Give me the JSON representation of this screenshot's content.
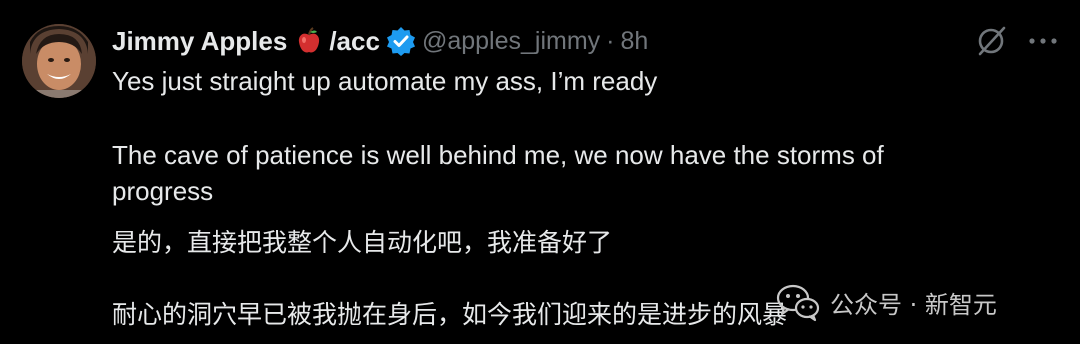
{
  "tweet": {
    "author_name": "Jimmy Apples",
    "author_suffix": "/acc",
    "handle": "@apples_jimmy",
    "separator": "·",
    "time": "8h",
    "avatar_icon": "avatar",
    "badge_icon": "verified-badge-icon",
    "apple_emoji_icon": "apple-emoji-icon",
    "action_icons": [
      "grok-icon",
      "more-icon"
    ],
    "text_line1": "Yes just straight up automate my ass, I’m ready",
    "text_line2": "The cave of patience is well behind me, we now have the storms of",
    "text_line3": "progress",
    "cn_line1": "是的，直接把我整个人自动化吧，我准备好了",
    "cn_line2": "耐心的洞穴早已被我抛在身后，如今我们迎来的是进步的风暴"
  },
  "watermark": {
    "text": "公众号 · 新智元",
    "icon": "wechat-logo-icon"
  },
  "colors": {
    "background": "#000000",
    "text": "#e7e9ea",
    "muted": "#71767b",
    "verified": "#1d9bf0",
    "apple": "#d32f2f"
  }
}
